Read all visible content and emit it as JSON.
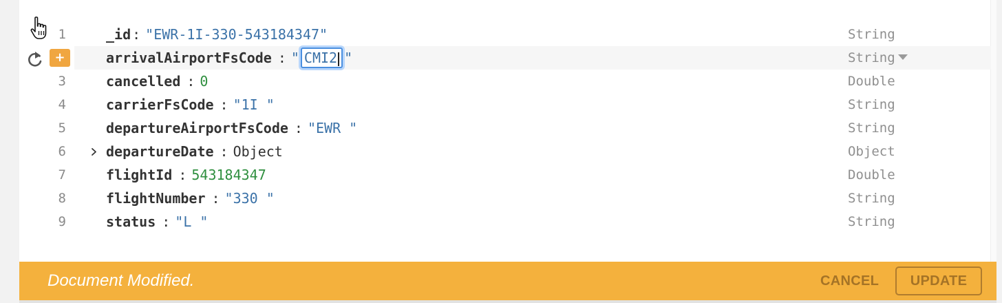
{
  "document": {
    "fields": [
      {
        "line": "1",
        "key": "_id",
        "value": "\"EWR-1I-330-543184347\"",
        "value_kind": "string",
        "type": "String"
      },
      {
        "line": "2",
        "key": "arrivalAirportFsCode",
        "value_open_quote": "\"",
        "edit_value": "CMI2",
        "value_close_quote": "\"",
        "value_kind": "string",
        "type": "String"
      },
      {
        "line": "3",
        "key": "cancelled",
        "value": "0",
        "value_kind": "number",
        "type": "Double"
      },
      {
        "line": "4",
        "key": "carrierFsCode",
        "value": "\"1I \"",
        "value_kind": "string",
        "type": "String"
      },
      {
        "line": "5",
        "key": "departureAirportFsCode",
        "value": "\"EWR \"",
        "value_kind": "string",
        "type": "String"
      },
      {
        "line": "6",
        "key": "departureDate",
        "value": "Object",
        "value_kind": "object",
        "type": "Object",
        "expand_icon": "chevron-right-icon"
      },
      {
        "line": "7",
        "key": "flightId",
        "value": "543184347",
        "value_kind": "number",
        "type": "Double"
      },
      {
        "line": "8",
        "key": "flightNumber",
        "value": "\"330 \"",
        "value_kind": "string",
        "type": "String"
      },
      {
        "line": "9",
        "key": "status",
        "value": "\"L \"",
        "value_kind": "string",
        "type": "String"
      }
    ],
    "colon": ":",
    "add_label": "+",
    "row_actions": [
      "revert-icon",
      "add-field-button"
    ],
    "type_dropdown_icon": "caret-down-icon",
    "cursor_icon": "hand-pointer-icon"
  },
  "footer": {
    "message": "Document Modified.",
    "cancel_label": "CANCEL",
    "update_label": "UPDATE"
  },
  "colors": {
    "footer_bg": "#f4b13d",
    "string_value": "#3b72a8",
    "number_value": "#2f8f3f",
    "input_focus": "#4a8fe0",
    "add_button": "#f0a640"
  }
}
